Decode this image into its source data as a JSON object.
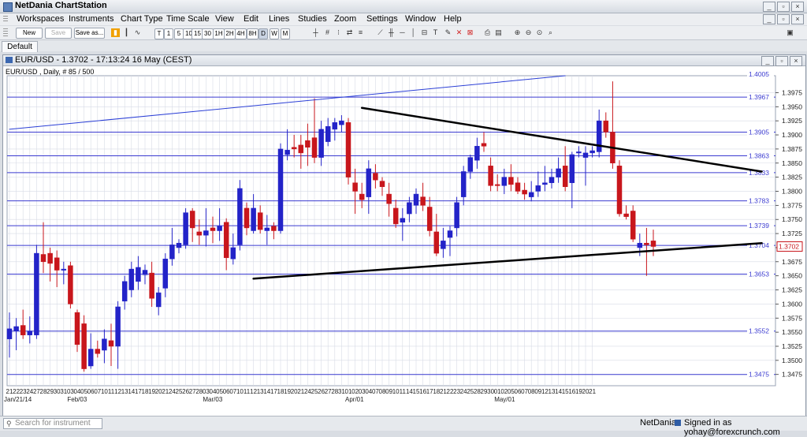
{
  "app": {
    "title": "NetDania ChartStation"
  },
  "menu": [
    "Workspaces",
    "Instruments",
    "Chart Type",
    "Time Scale",
    "View",
    "Edit",
    "Lines",
    "Studies",
    "Zoom",
    "Settings",
    "Window",
    "Help"
  ],
  "toolbar": {
    "new_label": "New",
    "save_label": "Save",
    "saveas_label": "Save as...",
    "timeframes": [
      "T",
      "1",
      "5",
      "10",
      "15",
      "30",
      "1H",
      "2H",
      "4H",
      "8H",
      "D",
      "W",
      "M"
    ],
    "selected_timeframe": "D"
  },
  "tabs": [
    {
      "label": "Default"
    }
  ],
  "chart_window": {
    "title": "EUR/USD - 1.3702 - 17:13:24  16 May (CEST)",
    "subtitle": "EUR/USD , Daily, # 85 / 500"
  },
  "chart_data": {
    "type": "candlestick",
    "instrument": "EUR/USD",
    "ylim": [
      1.3455,
      1.4005
    ],
    "y_ticks": [
      1.3475,
      1.35,
      1.3525,
      1.355,
      1.3575,
      1.36,
      1.3625,
      1.365,
      1.3675,
      1.37,
      1.3725,
      1.375,
      1.3775,
      1.38,
      1.3825,
      1.385,
      1.3875,
      1.39,
      1.3925,
      1.395,
      1.3975
    ],
    "x_day_labels": [
      "21",
      "22",
      "23",
      "24",
      "27",
      "28",
      "29",
      "30",
      "31",
      "03",
      "04",
      "05",
      "06",
      "07",
      "10",
      "11",
      "12",
      "13",
      "14",
      "17",
      "18",
      "19",
      "20",
      "21",
      "24",
      "25",
      "26",
      "27",
      "28",
      "03",
      "04",
      "05",
      "06",
      "07",
      "10",
      "11",
      "12",
      "13",
      "14",
      "17",
      "18",
      "19",
      "20",
      "21",
      "24",
      "25",
      "26",
      "27",
      "28",
      "31",
      "01",
      "02",
      "03",
      "04",
      "07",
      "08",
      "09",
      "10",
      "11",
      "14",
      "15",
      "16",
      "17",
      "18",
      "21",
      "22",
      "23",
      "24",
      "25",
      "28",
      "29",
      "30",
      "01",
      "02",
      "05",
      "06",
      "07",
      "08",
      "09",
      "12",
      "13",
      "14",
      "15",
      "16",
      "19",
      "20",
      "21"
    ],
    "x_month_labels": [
      {
        "label": "Jan/21/14",
        "index": 0
      },
      {
        "label": "Feb/03",
        "index": 9
      },
      {
        "label": "Mar/03",
        "index": 29
      },
      {
        "label": "Apr/01",
        "index": 50
      },
      {
        "label": "May/01",
        "index": 72
      }
    ],
    "price_levels": [
      {
        "label": "1.3967",
        "value": 1.3967
      },
      {
        "label": "1.3905",
        "value": 1.3905
      },
      {
        "label": "1.3863",
        "value": 1.3863
      },
      {
        "label": "1.3833",
        "value": 1.3833
      },
      {
        "label": "1.3783",
        "value": 1.3783
      },
      {
        "label": "1.3739",
        "value": 1.3739
      },
      {
        "label": "1.3704",
        "value": 1.3704
      },
      {
        "label": "1.3653",
        "value": 1.3653
      },
      {
        "label": "1.3552",
        "value": 1.3552
      },
      {
        "label": "1.3475",
        "value": 1.3475
      }
    ],
    "top_level_label": "1.4005",
    "current_price": {
      "label": "1.3702",
      "value": 1.3702
    },
    "candles": [
      {
        "o": 1.3538,
        "h": 1.3585,
        "l": 1.3505,
        "c": 1.3556
      },
      {
        "o": 1.3552,
        "h": 1.3575,
        "l": 1.3518,
        "c": 1.356
      },
      {
        "o": 1.3562,
        "h": 1.359,
        "l": 1.3538,
        "c": 1.3545
      },
      {
        "o": 1.3545,
        "h": 1.3578,
        "l": 1.353,
        "c": 1.3552
      },
      {
        "o": 1.3545,
        "h": 1.3705,
        "l": 1.3538,
        "c": 1.369
      },
      {
        "o": 1.3688,
        "h": 1.3745,
        "l": 1.3655,
        "c": 1.3675
      },
      {
        "o": 1.369,
        "h": 1.37,
        "l": 1.364,
        "c": 1.3672
      },
      {
        "o": 1.3682,
        "h": 1.3695,
        "l": 1.363,
        "c": 1.366
      },
      {
        "o": 1.3662,
        "h": 1.3675,
        "l": 1.3635,
        "c": 1.3662
      },
      {
        "o": 1.3668,
        "h": 1.3675,
        "l": 1.3592,
        "c": 1.36
      },
      {
        "o": 1.3585,
        "h": 1.359,
        "l": 1.3515,
        "c": 1.3528
      },
      {
        "o": 1.3565,
        "h": 1.358,
        "l": 1.348,
        "c": 1.3485
      },
      {
        "o": 1.349,
        "h": 1.3548,
        "l": 1.3485,
        "c": 1.352
      },
      {
        "o": 1.352,
        "h": 1.3535,
        "l": 1.3505,
        "c": 1.3512
      },
      {
        "o": 1.3518,
        "h": 1.3555,
        "l": 1.3495,
        "c": 1.3538
      },
      {
        "o": 1.3535,
        "h": 1.3565,
        "l": 1.349,
        "c": 1.3525
      },
      {
        "o": 1.3525,
        "h": 1.3605,
        "l": 1.3485,
        "c": 1.3595
      },
      {
        "o": 1.3605,
        "h": 1.365,
        "l": 1.359,
        "c": 1.364
      },
      {
        "o": 1.3625,
        "h": 1.3675,
        "l": 1.3612,
        "c": 1.3662
      },
      {
        "o": 1.364,
        "h": 1.3685,
        "l": 1.3625,
        "c": 1.3665
      },
      {
        "o": 1.3652,
        "h": 1.367,
        "l": 1.3635,
        "c": 1.366
      },
      {
        "o": 1.3655,
        "h": 1.3675,
        "l": 1.3595,
        "c": 1.361
      },
      {
        "o": 1.3595,
        "h": 1.363,
        "l": 1.358,
        "c": 1.362
      },
      {
        "o": 1.3628,
        "h": 1.369,
        "l": 1.3612,
        "c": 1.368
      },
      {
        "o": 1.368,
        "h": 1.3735,
        "l": 1.3668,
        "c": 1.3705
      },
      {
        "o": 1.37,
        "h": 1.3715,
        "l": 1.369,
        "c": 1.3708
      },
      {
        "o": 1.3705,
        "h": 1.377,
        "l": 1.3698,
        "c": 1.3762
      },
      {
        "o": 1.3765,
        "h": 1.377,
        "l": 1.371,
        "c": 1.3735
      },
      {
        "o": 1.3728,
        "h": 1.375,
        "l": 1.3705,
        "c": 1.3722
      },
      {
        "o": 1.3722,
        "h": 1.377,
        "l": 1.3702,
        "c": 1.373
      },
      {
        "o": 1.3735,
        "h": 1.3755,
        "l": 1.3708,
        "c": 1.373
      },
      {
        "o": 1.373,
        "h": 1.377,
        "l": 1.3712,
        "c": 1.3738
      },
      {
        "o": 1.3745,
        "h": 1.3752,
        "l": 1.366,
        "c": 1.3682
      },
      {
        "o": 1.368,
        "h": 1.3725,
        "l": 1.367,
        "c": 1.37
      },
      {
        "o": 1.3705,
        "h": 1.382,
        "l": 1.3695,
        "c": 1.3805
      },
      {
        "o": 1.377,
        "h": 1.378,
        "l": 1.3722,
        "c": 1.3735
      },
      {
        "o": 1.373,
        "h": 1.3795,
        "l": 1.3725,
        "c": 1.377
      },
      {
        "o": 1.3762,
        "h": 1.3775,
        "l": 1.3725,
        "c": 1.3732
      },
      {
        "o": 1.373,
        "h": 1.3758,
        "l": 1.3705,
        "c": 1.3735
      },
      {
        "o": 1.3738,
        "h": 1.3745,
        "l": 1.3715,
        "c": 1.373
      },
      {
        "o": 1.373,
        "h": 1.3885,
        "l": 1.3725,
        "c": 1.3875
      },
      {
        "o": 1.3865,
        "h": 1.391,
        "l": 1.3855,
        "c": 1.3873
      },
      {
        "o": 1.3878,
        "h": 1.39,
        "l": 1.386,
        "c": 1.3875
      },
      {
        "o": 1.3882,
        "h": 1.39,
        "l": 1.384,
        "c": 1.3868
      },
      {
        "o": 1.389,
        "h": 1.392,
        "l": 1.3845,
        "c": 1.3878
      },
      {
        "o": 1.3895,
        "h": 1.3965,
        "l": 1.385,
        "c": 1.386
      },
      {
        "o": 1.386,
        "h": 1.3925,
        "l": 1.3845,
        "c": 1.391
      },
      {
        "o": 1.3888,
        "h": 1.393,
        "l": 1.388,
        "c": 1.3915
      },
      {
        "o": 1.391,
        "h": 1.393,
        "l": 1.389,
        "c": 1.3922
      },
      {
        "o": 1.3918,
        "h": 1.3935,
        "l": 1.3905,
        "c": 1.3925
      },
      {
        "o": 1.3922,
        "h": 1.393,
        "l": 1.3812,
        "c": 1.3825
      },
      {
        "o": 1.3815,
        "h": 1.384,
        "l": 1.376,
        "c": 1.38
      },
      {
        "o": 1.3795,
        "h": 1.3815,
        "l": 1.377,
        "c": 1.3785
      },
      {
        "o": 1.379,
        "h": 1.3855,
        "l": 1.376,
        "c": 1.384
      },
      {
        "o": 1.3832,
        "h": 1.3848,
        "l": 1.3805,
        "c": 1.382
      },
      {
        "o": 1.3818,
        "h": 1.3825,
        "l": 1.3792,
        "c": 1.3808
      },
      {
        "o": 1.3795,
        "h": 1.3815,
        "l": 1.3755,
        "c": 1.3778
      },
      {
        "o": 1.377,
        "h": 1.3785,
        "l": 1.3735,
        "c": 1.3742
      },
      {
        "o": 1.3745,
        "h": 1.377,
        "l": 1.3712,
        "c": 1.3752
      },
      {
        "o": 1.376,
        "h": 1.379,
        "l": 1.3745,
        "c": 1.378
      },
      {
        "o": 1.3775,
        "h": 1.3805,
        "l": 1.376,
        "c": 1.3795
      },
      {
        "o": 1.379,
        "h": 1.3815,
        "l": 1.3765,
        "c": 1.3775
      },
      {
        "o": 1.3772,
        "h": 1.379,
        "l": 1.372,
        "c": 1.373
      },
      {
        "o": 1.3728,
        "h": 1.376,
        "l": 1.3685,
        "c": 1.369
      },
      {
        "o": 1.3698,
        "h": 1.3735,
        "l": 1.3682,
        "c": 1.3712
      },
      {
        "o": 1.3718,
        "h": 1.3738,
        "l": 1.3685,
        "c": 1.373
      },
      {
        "o": 1.3735,
        "h": 1.379,
        "l": 1.372,
        "c": 1.378
      },
      {
        "o": 1.379,
        "h": 1.3845,
        "l": 1.3775,
        "c": 1.3835
      },
      {
        "o": 1.3835,
        "h": 1.3865,
        "l": 1.3822,
        "c": 1.386
      },
      {
        "o": 1.3855,
        "h": 1.3895,
        "l": 1.384,
        "c": 1.388
      },
      {
        "o": 1.3885,
        "h": 1.3905,
        "l": 1.387,
        "c": 1.388
      },
      {
        "o": 1.3845,
        "h": 1.386,
        "l": 1.38,
        "c": 1.381
      },
      {
        "o": 1.3812,
        "h": 1.383,
        "l": 1.38,
        "c": 1.381
      },
      {
        "o": 1.381,
        "h": 1.384,
        "l": 1.3795,
        "c": 1.3825
      },
      {
        "o": 1.3825,
        "h": 1.3848,
        "l": 1.38,
        "c": 1.3812
      },
      {
        "o": 1.3815,
        "h": 1.3825,
        "l": 1.3795,
        "c": 1.38
      },
      {
        "o": 1.3802,
        "h": 1.3815,
        "l": 1.3785,
        "c": 1.3795
      },
      {
        "o": 1.379,
        "h": 1.3818,
        "l": 1.3782,
        "c": 1.3798
      },
      {
        "o": 1.38,
        "h": 1.3835,
        "l": 1.379,
        "c": 1.381
      },
      {
        "o": 1.3812,
        "h": 1.3845,
        "l": 1.38,
        "c": 1.3815
      },
      {
        "o": 1.3815,
        "h": 1.384,
        "l": 1.3805,
        "c": 1.3825
      },
      {
        "o": 1.3825,
        "h": 1.386,
        "l": 1.3815,
        "c": 1.384
      },
      {
        "o": 1.3845,
        "h": 1.388,
        "l": 1.38,
        "c": 1.3808
      },
      {
        "o": 1.3815,
        "h": 1.387,
        "l": 1.377,
        "c": 1.3865
      },
      {
        "o": 1.3868,
        "h": 1.388,
        "l": 1.386,
        "c": 1.387
      },
      {
        "o": 1.386,
        "h": 1.388,
        "l": 1.381,
        "c": 1.3868
      },
      {
        "o": 1.3868,
        "h": 1.388,
        "l": 1.386,
        "c": 1.3872
      },
      {
        "o": 1.387,
        "h": 1.3945,
        "l": 1.386,
        "c": 1.3925
      },
      {
        "o": 1.3925,
        "h": 1.394,
        "l": 1.3895,
        "c": 1.3905
      },
      {
        "o": 1.3905,
        "h": 1.3995,
        "l": 1.384,
        "c": 1.385
      },
      {
        "o": 1.3845,
        "h": 1.3855,
        "l": 1.3755,
        "c": 1.376
      },
      {
        "o": 1.376,
        "h": 1.3775,
        "l": 1.375,
        "c": 1.3755
      },
      {
        "o": 1.3765,
        "h": 1.3775,
        "l": 1.371,
        "c": 1.3715
      },
      {
        "o": 1.37,
        "h": 1.3725,
        "l": 1.3685,
        "c": 1.3708
      },
      {
        "o": 1.3708,
        "h": 1.3735,
        "l": 1.365,
        "c": 1.3705
      },
      {
        "o": 1.3712,
        "h": 1.3732,
        "l": 1.3685,
        "c": 1.3702
      }
    ],
    "trendlines": [
      {
        "name": "upper-resistance",
        "from": {
          "i": 0,
          "p": 1.391
        },
        "to": {
          "i": 82,
          "p": 1.4005
        },
        "color": "#2b3fd6",
        "width": 1
      },
      {
        "name": "descending",
        "from": {
          "i": 52,
          "p": 1.3948
        },
        "to": {
          "i": 111,
          "p": 1.3835
        },
        "color": "#000000",
        "width": 2.5
      },
      {
        "name": "ascending",
        "from": {
          "i": 36,
          "p": 1.3645
        },
        "to": {
          "i": 111,
          "p": 1.3708
        },
        "color": "#000000",
        "width": 2.5
      }
    ],
    "colors": {
      "up": "#2323c8",
      "down": "#c8161c",
      "grid": "#d7dbe6",
      "level": "#3b3bd0"
    },
    "grid": true
  },
  "search": {
    "placeholder": "Search for instrument"
  },
  "status": {
    "brand": "NetDania",
    "login_text": "Signed in as yohay@forexcrunch.com"
  }
}
